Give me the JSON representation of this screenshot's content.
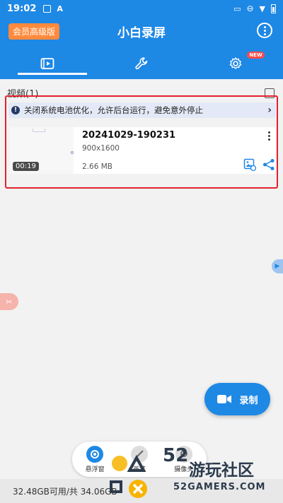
{
  "status_bar": {
    "time": "19:02"
  },
  "app_bar": {
    "vip_label": "会员高级版",
    "title": "小白录屏",
    "tabs": [
      {
        "icon": "video-list-icon",
        "active": true
      },
      {
        "icon": "wrench-icon",
        "active": false
      },
      {
        "icon": "gear-icon",
        "active": false,
        "badge": "NEW"
      }
    ]
  },
  "videos": {
    "header": "视频(1)",
    "notice": "关闭系统电池优化，允许后台运行，避免意外停止",
    "items": [
      {
        "name": "20241029-190231",
        "resolution": "900x1600",
        "size": "2.66 MB",
        "duration": "00:19"
      }
    ]
  },
  "record_button": {
    "label": "录制"
  },
  "floating_bar": {
    "items": [
      "悬浮窗",
      "画笔",
      "摄像头"
    ]
  },
  "footer": {
    "storage": "32.48GB可用/共 34.06GB"
  },
  "watermark": {
    "number": "52",
    "chinese": "游玩社区",
    "english": "52GAMERS.COM"
  },
  "colors": {
    "primary": "#1e88e5",
    "vip": "#ff8a3d",
    "highlight": "#e5212d"
  }
}
